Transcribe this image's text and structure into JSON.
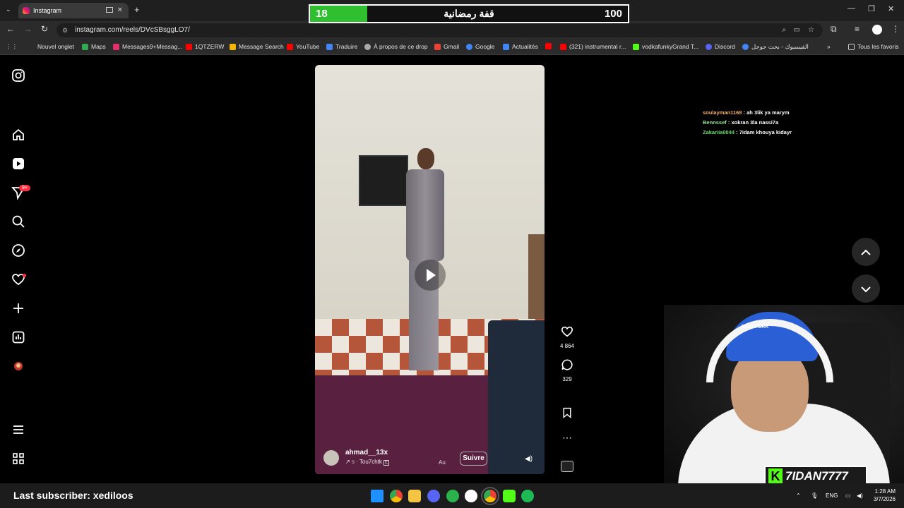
{
  "browser": {
    "tab_title": "Instagram",
    "url": "instagram.com/reels/DVcSBsggLO7/",
    "bookmarks": [
      {
        "label": "Nouvel onglet",
        "icon": "grid-icon",
        "color": "#cccccc"
      },
      {
        "label": "Maps",
        "icon": "maps-icon",
        "color": "#34a853"
      },
      {
        "label": "Messages9+Messag...",
        "icon": "instagram-icon",
        "color": "#e1306c"
      },
      {
        "label": "1QTZERW",
        "icon": "youtube-icon",
        "color": "#ff0000"
      },
      {
        "label": "Message Search",
        "icon": "chart-icon",
        "color": "#f4b400"
      },
      {
        "label": "YouTube",
        "icon": "youtube-icon",
        "color": "#ff0000"
      },
      {
        "label": "Traduire",
        "icon": "translate-icon",
        "color": "#4285f4"
      },
      {
        "label": "À propos de ce drop",
        "icon": "globe-icon",
        "color": "#aaaaaa"
      },
      {
        "label": "Gmail",
        "icon": "gmail-icon",
        "color": "#ea4335"
      },
      {
        "label": "Google",
        "icon": "google-icon",
        "color": "#4285f4"
      },
      {
        "label": "Actualités",
        "icon": "news-icon",
        "color": "#4285f4"
      },
      {
        "label": "",
        "icon": "youtube-icon",
        "color": "#ff0000"
      },
      {
        "label": "(321) instrumental r...",
        "icon": "youtube-icon",
        "color": "#ff0000"
      },
      {
        "label": "vodkafunkyGrand T...",
        "icon": "kick-icon",
        "color": "#53fc18"
      },
      {
        "label": "Discord",
        "icon": "discord-icon",
        "color": "#5865f2"
      },
      {
        "label": "الفيسبوك - بحث جوجل",
        "icon": "google-icon",
        "color": "#4285f4"
      }
    ],
    "all_bookmarks": "Tous les favoris"
  },
  "overlay_counter": {
    "left_value": "18",
    "title": "قفة رمضانية",
    "right_value": "100",
    "progress_fraction": 0.18,
    "fill_color": "#2fbf2f"
  },
  "sidebar": {
    "notifications_badge": "9+"
  },
  "reel": {
    "author": "ahmad__13x",
    "audio": "Tou7chtk",
    "date_partial": "Au",
    "follow_label": "Suivre",
    "likes": "4 864",
    "comments": "329"
  },
  "chat": [
    {
      "user": "soulayman1168",
      "message": "ah 3lik ya marym"
    },
    {
      "user": "Bennssef",
      "message": "xokran 3la nassi7a"
    },
    {
      "user": "Zakariia0044",
      "message": "7idam khouya kidayr"
    }
  ],
  "webcam": {
    "cap_text": "NEW YORK",
    "channel_name": "7IDAN7777"
  },
  "taskbar": {
    "last_subscriber": "Last subscriber: xediloos",
    "lang": "ENG",
    "time": "1:28 AM",
    "date": "3/7/2026"
  }
}
